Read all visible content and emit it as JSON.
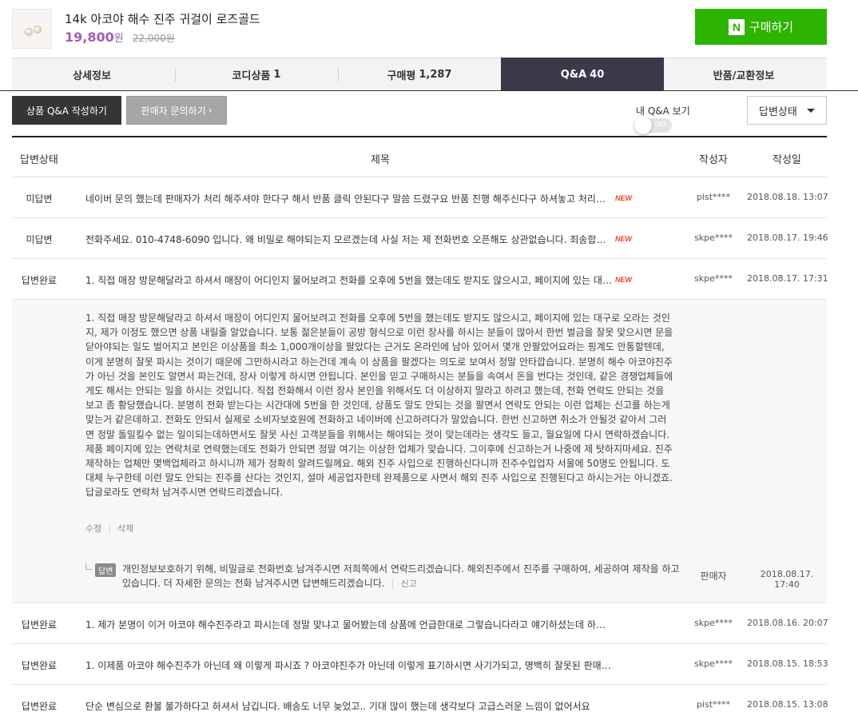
{
  "product": {
    "title": "14k 아코야 해수 진주 귀걸이 로즈골드",
    "price": "19,800",
    "price_unit": "원",
    "original_price": "22,000원",
    "buy_label": "구매하기",
    "naver_logo": "N"
  },
  "tabs": [
    {
      "label": "상세정보",
      "count": ""
    },
    {
      "label": "코디상품",
      "count": "1"
    },
    {
      "label": "구매평",
      "count": "1,287"
    },
    {
      "label": "Q&A",
      "count": "40"
    },
    {
      "label": "반품/교환정보",
      "count": ""
    }
  ],
  "actions": {
    "write_qa": "상품 Q&A 작성하기",
    "seller_inquiry": "판매자 문의하기",
    "my_qa_label": "내 Q&A 보기",
    "toggle_state": "OFF",
    "status_filter": "답변상태"
  },
  "table": {
    "headers": {
      "status": "답변상태",
      "title": "제목",
      "author": "작성자",
      "date": "작성일"
    },
    "new_badge": "NEW",
    "rows": [
      {
        "status": "미답변",
        "title": "네이버 문의 했는데 판매자가 처리 해주셔야 한다구 해서 반품 클릭 안된다구 말씀 드렸구요 반품 진행 해주신다구 하셔놓고 처리가 안되네요",
        "new": "NEW",
        "author": "pist****",
        "date": "2018.08.18. 13:07"
      },
      {
        "status": "미답변",
        "title": "전화주세요. 010-4748-6090 입니다. 왜 비밀로 해야되는지 모르겠는데 사실 저는 제 전화번호 오픈해도 상관없습니다. 죄송합니다",
        "new": "NEW",
        "author": "skpe****",
        "date": "2018.08.17. 19:46"
      },
      {
        "status": "답변완료",
        "title": "1. 직접 매장 방문해달라고 하셔서 매장이 어디인지 물어보려고 전화를 오후에 5번을 했는데도 받지도 않으시고, 페이지에 있는 대구로",
        "new": "NEW",
        "author": "skpe****",
        "date": "2018.08.17. 17:31"
      }
    ],
    "expanded": {
      "body": "1. 직접 매장 방문해달라고 하셔서 매장이 어디인지 물어보려고 전화를 오후에 5번을 했는데도 받지도 않으시고, 페이지에 있는 대구로 오라는 것인지, 제가 이정도 했으면 상품 내릴줄 알았습니다. 보통 젊은분들이 공방 형식으로 이런 장사를 하시는 분들이 많아서 한번 벌금을 잘못 맞으시면 문을 닫아야되는 일도 벌어지고 본인은 이상품을 최소 1,000개이상을 팔았다는 근거도 온라인에 남아 있어서 몇개 안팔았어요라는 핑계도 안통할텐데, 이게 분명히 잘못 파시는 것이기 때문에 그만하시라고 하는건데 계속 이 상품을 팔겠다는 의도로 보여서 정말 안타깝습니다. 분명히 해수 아코야진주가 아닌 것을 본인도 알면서 파는건데, 장사 이렇게 하시면 안됩니다. 본인을 믿고 구매하시는 분들을 속여서 돈을 번다는 것인데, 같은 경쟁업체들에게도 해서는 안되는 일을 하시는 것입니다. 직접 전화해서 이런 장사 본인을 위해서도 더 이상하지 말라고 하려고 했는데, 전화 연락도 안되는 것을 보고 좀 황당했습니다. 분명히 전화 받는다는 시간대에 5번을 한 것인데, 상품도 말도 안되는 것을 팔면서 연락도 안되는 이런 업체는 신고를 하는게 맞는거 같은데하고. 전화도 안되서 실제로 소비자보호원에 전화하고 네이버에 신고하려다가 말았습니다. 한번 신고하면 취소가 안될것 같아서 그러면 정말 돌일킬수 없는 일이되는데하면서도 잘못 사신 고객분들을 위해서는 해야되는 것이 맞는데라는 생각도 들고, 월요일에 다시 연락하겠습니다. 제품 페이지에 있는 연락처로 연락했는데도 전화가 안되면 정말 여기는 이상한 업체가 맞습니다. 그이후에 신고하는거 나중에 제 탓하지마세요. 진주 제작하는 업체만 몇백업체라고 하시니까 제가 정확히 알려드릴께요. 해외 진주 사입으로 진행하신다니까 진주수입업자 서울에 50명도 안됩니다. 도대체 누구한테 이런 말도 안되는 진주를 산다는 것인지, 설마 세공업자한테 완제품으로 사면서 해외 진주 사입으로 진행된다고 하시는거는 아니겠죠. 답글로라도 연락처 남겨주시면 연락드리겠습니다.",
      "edit": "수정",
      "delete": "삭제",
      "reply": {
        "badge": "답변",
        "text": "개인정보보호하기 위해, 비밀글로 전화번호 남겨주시면 저희쪽에서 연락드리겠습니다. 해외진주에서 진주를 구매하여, 세공하여 제작을 하고 있습니다. 더 자세한 문의는 전화 남겨주시면 답변해드리겠습니다.",
        "report": "신고",
        "author": "판매자",
        "date": "2018.08.17. 17:40"
      }
    },
    "rows_after": [
      {
        "status": "답변완료",
        "title": "1. 제가 분명이 이거 아코야 해수진주라고 파시는데 정말 맞냐고 물어봤는데 상품에 언급한대로 그렇습니다라고 얘기하셨는데 하나도 안맞아요",
        "author": "skpe****",
        "date": "2018.08.16. 20:07"
      },
      {
        "status": "답변완료",
        "title": "1. 이제품 아코야 해수진주가 아닌데 왜 이렇게 파시죠 ? 아코야진주가 아닌데 이렇게 표기하시면 사기가되고, 명백히 잘못된 판매입니다",
        "author": "skpe****",
        "date": "2018.08.15. 18:53"
      },
      {
        "status": "답변완료",
        "title": "단순 변심으로 환불 불가하다고 하셔서 남깁니다. 배송도 너무 늦었고.. 기대 많이 했는데 생각보다 고급스러운 느낌이 없어서요",
        "author": "pist****",
        "date": "2018.08.15. 13:08"
      }
    ]
  }
}
